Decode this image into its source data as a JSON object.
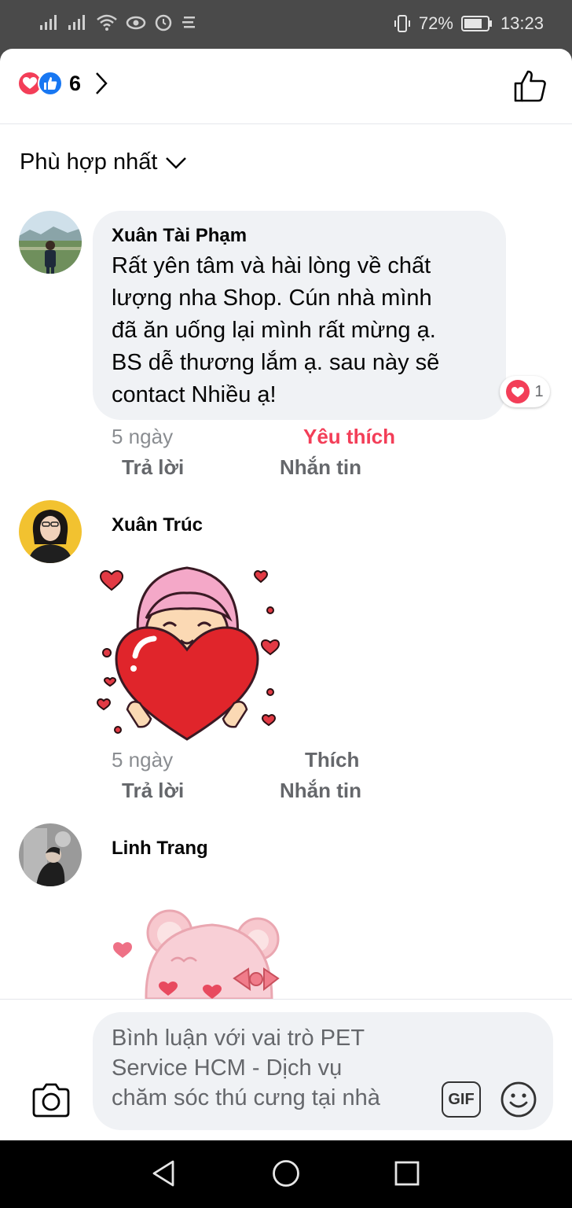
{
  "status_bar": {
    "battery": "72%",
    "time": "13:23",
    "icons": [
      "signal-icon",
      "signal-icon",
      "wifi-icon",
      "eye-icon",
      "alarm-icon",
      "menu-icon",
      "vibrate-icon",
      "battery-icon"
    ]
  },
  "header": {
    "reaction_count": "6",
    "icons": [
      "love-reaction-icon",
      "like-reaction-icon",
      "chevron-right-icon",
      "like-outline-icon"
    ]
  },
  "sort": {
    "label": "Phù hợp nhất"
  },
  "comments": [
    {
      "name": "Xuân Tài Phạm",
      "text_lines": [
        "Rất yên tâm và hài lòng về chất",
        "lượng nha Shop. Cún nhà mình",
        "đã ăn uống lại mình rất mừng ạ.",
        "BS dễ thương lắm ạ. sau này sẽ",
        "contact Nhiều ạ!"
      ],
      "reaction_count": "1",
      "time": "5 ngày",
      "react_label": "Yêu thích",
      "reply_label": "Trả lời",
      "message_label": "Nhắn tin"
    },
    {
      "name": "Xuân Trúc",
      "time": "5 ngày",
      "react_label": "Thích",
      "reply_label": "Trả lời",
      "message_label": "Nhắn tin"
    },
    {
      "name": "Linh Trang"
    }
  ],
  "composer": {
    "placeholder": "Bình luận với vai trò PET Service HCM - Dịch vụ chăm sóc thú cưng tại nhà",
    "placeholder_lines": [
      "Bình luận với vai trò PET",
      "Service HCM - Dịch vụ",
      "chăm sóc thú cưng tại nhà"
    ],
    "gif_label": "GIF"
  },
  "colors": {
    "love": "#f33e58",
    "like": "#1877f2",
    "bubble": "#f0f2f5",
    "meta_text": "#65676b"
  }
}
